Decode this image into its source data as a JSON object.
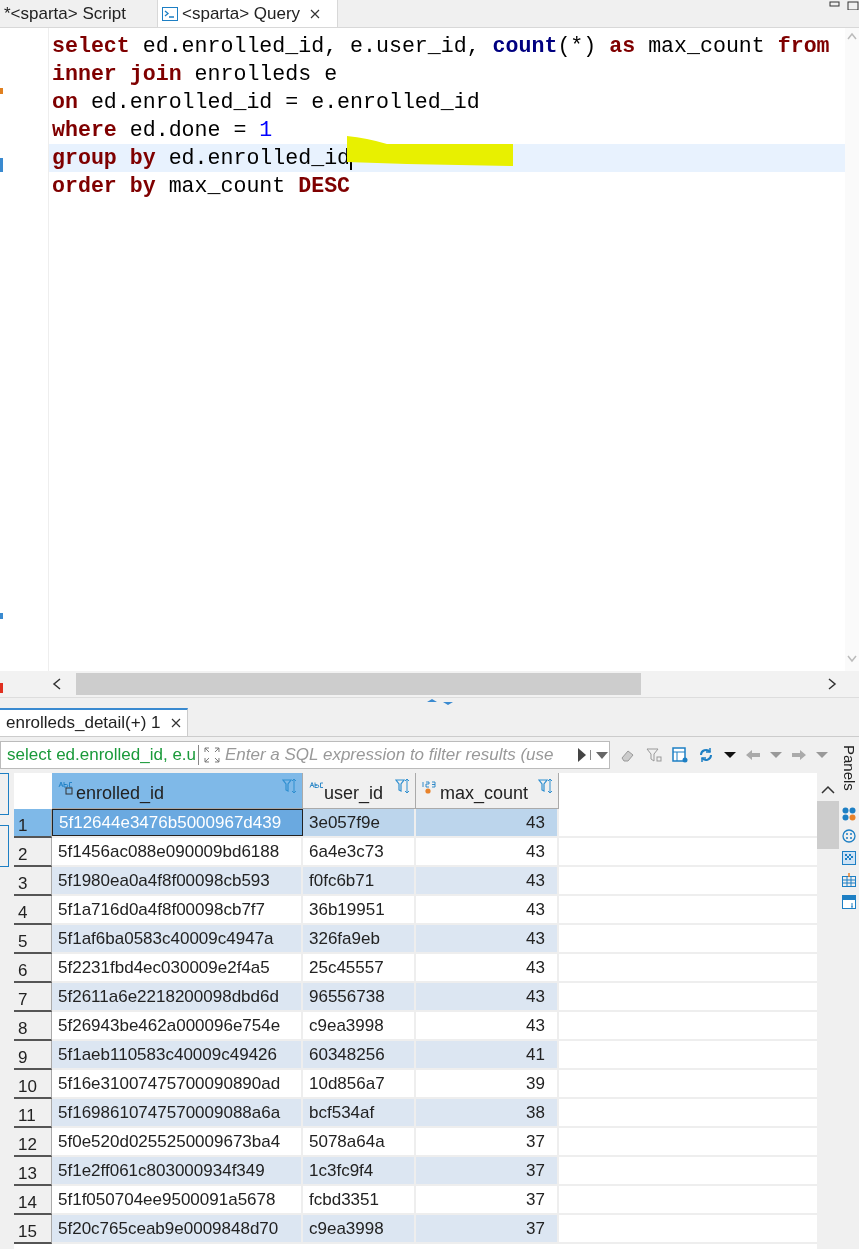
{
  "editor_tabs": [
    {
      "label": "*<sparta> Script",
      "selected": false,
      "closable": false,
      "icon": false
    },
    {
      "label": "<sparta> Query",
      "selected": true,
      "closable": true,
      "icon": true
    }
  ],
  "editor": {
    "lines": [
      {
        "current": false,
        "tokens": [
          {
            "kind": "keyword",
            "text": "select"
          },
          {
            "kind": "plain",
            "text": " ed.enrolled_id, e.user_id, "
          },
          {
            "kind": "function",
            "text": "count"
          },
          {
            "kind": "plain",
            "text": "(*) "
          },
          {
            "kind": "keyword",
            "text": "as"
          },
          {
            "kind": "plain",
            "text": " max_count "
          },
          {
            "kind": "keyword",
            "text": "from"
          }
        ]
      },
      {
        "current": false,
        "tokens": [
          {
            "kind": "keyword",
            "text": "inner join"
          },
          {
            "kind": "plain",
            "text": " enrolleds e"
          }
        ]
      },
      {
        "current": false,
        "tokens": [
          {
            "kind": "keyword",
            "text": "on"
          },
          {
            "kind": "plain",
            "text": " ed.enrolled_id = e.enrolled_id"
          }
        ]
      },
      {
        "current": false,
        "tokens": [
          {
            "kind": "keyword",
            "text": "where"
          },
          {
            "kind": "plain",
            "text": " ed.done = "
          },
          {
            "kind": "number",
            "text": "1"
          }
        ]
      },
      {
        "current": true,
        "tokens": [
          {
            "kind": "keyword",
            "text": "group by"
          },
          {
            "kind": "plain",
            "text": " ed.enrolled_id"
          }
        ]
      },
      {
        "current": false,
        "tokens": [
          {
            "kind": "keyword",
            "text": "order by"
          },
          {
            "kind": "plain",
            "text": " max_count "
          },
          {
            "kind": "keyword",
            "text": "DESC"
          }
        ]
      }
    ]
  },
  "results_tab": {
    "label": "enrolleds_detail(+) 1"
  },
  "filter": {
    "query": "select ed.enrolled_id, e.u",
    "placeholder": "Enter a SQL expression to filter results (use"
  },
  "table": {
    "columns": [
      {
        "label": "enrolled_id",
        "kind": "text",
        "selected": true
      },
      {
        "label": "user_id",
        "kind": "text",
        "selected": false
      },
      {
        "label": "max_count",
        "kind": "number",
        "selected": false
      }
    ],
    "rows": [
      {
        "number": "1",
        "selected": true,
        "cells": [
          "5f12644e3476b5000967d439",
          "3e057f9e",
          "43"
        ]
      },
      {
        "number": "2",
        "selected": false,
        "cells": [
          "5f1456ac088e090009bd6188",
          "6a4e3c73",
          "43"
        ]
      },
      {
        "number": "3",
        "selected": false,
        "cells": [
          "5f1980ea0a4f8f00098cb593",
          "f0fc6b71",
          "43"
        ]
      },
      {
        "number": "4",
        "selected": false,
        "cells": [
          "5f1a716d0a4f8f00098cb7f7",
          "36b19951",
          "43"
        ]
      },
      {
        "number": "5",
        "selected": false,
        "cells": [
          "5f1af6ba0583c40009c4947a",
          "326fa9eb",
          "43"
        ]
      },
      {
        "number": "6",
        "selected": false,
        "cells": [
          "5f2231fbd4ec030009e2f4a5",
          "25c45557",
          "43"
        ]
      },
      {
        "number": "7",
        "selected": false,
        "cells": [
          "5f2611a6e2218200098dbd6d",
          "96556738",
          "43"
        ]
      },
      {
        "number": "8",
        "selected": false,
        "cells": [
          "5f26943be462a000096e754e",
          "c9ea3998",
          "43"
        ]
      },
      {
        "number": "9",
        "selected": false,
        "cells": [
          "5f1aeb110583c40009c49426",
          "60348256",
          "41"
        ]
      },
      {
        "number": "10",
        "selected": false,
        "cells": [
          "5f16e31007475700090890ad",
          "10d856a7",
          "39"
        ]
      },
      {
        "number": "11",
        "selected": false,
        "cells": [
          "5f1698610747570009088a6a",
          "bcf534af",
          "38"
        ]
      },
      {
        "number": "12",
        "selected": false,
        "cells": [
          "5f0e520d0255250009673ba4",
          "5078a64a",
          "37"
        ]
      },
      {
        "number": "13",
        "selected": false,
        "cells": [
          "5f1e2ff061c803000934f349",
          "1c3fc9f4",
          "37"
        ]
      },
      {
        "number": "14",
        "selected": false,
        "cells": [
          "5f1f050704ee9500091a5678",
          "fcbd3351",
          "37"
        ]
      },
      {
        "number": "15",
        "selected": false,
        "cells": [
          "5f20c765ceab9e0009848d70",
          "c9ea3998",
          "37"
        ]
      }
    ]
  },
  "panels_label": "Panels"
}
